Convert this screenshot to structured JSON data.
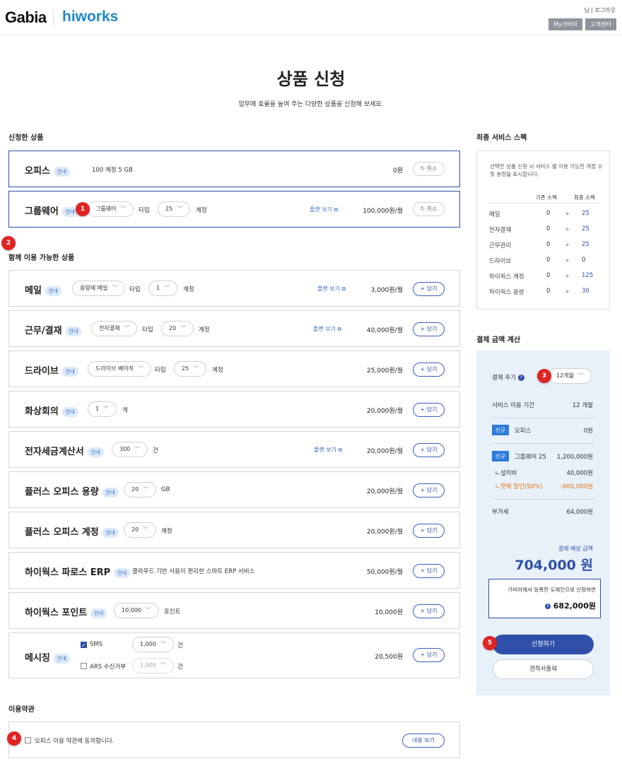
{
  "header": {
    "logo_gabia": "Gabia",
    "logo_hiworks": "hiworks",
    "user_links": "님 | 로그아웃",
    "my_gabia": "My가비아",
    "support": "고객센터"
  },
  "page": {
    "title": "상품 신청",
    "subtitle": "업무에 효율을 높여 주는 다양한 상품을 신청해 보세요."
  },
  "applied": {
    "section_title": "신청한 상품",
    "office": {
      "name": "오피스",
      "badge": "안내",
      "desc": "100 계정 5 GB",
      "price": "0원",
      "cancel": "취소"
    },
    "groupware": {
      "name": "그룹웨어",
      "badge": "안내",
      "type_select": "그룹웨어",
      "type_label": "타입",
      "count_select": "25",
      "unit": "계정",
      "plan": "플랜 보기",
      "price": "100,000원/월",
      "cancel": "취소"
    }
  },
  "available": {
    "section_title": "함께 이용 가능한 상품",
    "add_label": "담기",
    "mail": {
      "name": "메일",
      "badge": "안내",
      "type_select": "용량제 메일",
      "type_label": "타입",
      "count_select": "1",
      "unit": "계정",
      "plan": "플랜 보기",
      "price": "3,000원/월"
    },
    "approval": {
      "name": "근무/결재",
      "badge": "안내",
      "type_select": "전자결재",
      "type_label": "타입",
      "count_select": "20",
      "unit": "계정",
      "plan": "플랜 보기",
      "price": "40,000원/월"
    },
    "drive": {
      "name": "드라이브",
      "badge": "안내",
      "type_select": "드라이브 베이직",
      "type_label": "타입",
      "count_select": "25",
      "unit": "계정",
      "price": "25,000원/월"
    },
    "video": {
      "name": "화상회의",
      "badge": "안내",
      "count_select": "1",
      "unit": "개",
      "price": "20,000원/월"
    },
    "tax": {
      "name": "전자세금계산서",
      "badge": "안내",
      "count_select": "300",
      "unit": "건",
      "plan": "플랜 보기",
      "price": "20,000원/월"
    },
    "plus_storage": {
      "name": "플러스 오피스 용량",
      "badge": "안내",
      "count_select": "20",
      "unit": "GB",
      "price": "20,000원/월"
    },
    "plus_account": {
      "name": "플러스 오피스 계정",
      "badge": "안내",
      "count_select": "20",
      "unit": "계정",
      "price": "20,000원/월"
    },
    "erp": {
      "name": "하이웍스 파로스 ERP",
      "badge": "안내",
      "desc": "클라우드 기반 사용이 편리한 스마트 ERP 서비스",
      "price": "50,000원/월"
    },
    "point": {
      "name": "하이웍스 포인트",
      "badge": "안내",
      "count_select": "10,000",
      "unit": "포인트",
      "price": "10,000원"
    },
    "messaging": {
      "name": "메시징",
      "badge": "안내",
      "sms_label": "SMS",
      "sms_select": "1,000",
      "sms_unit": "건",
      "ars_label": "ARS 수신거부",
      "ars_select": "1,000",
      "ars_unit": "건",
      "price": "20,500원"
    }
  },
  "terms": {
    "section_title": "이용약관",
    "agree_text": "오피스 이용 약관에 동의합니다.",
    "view_button": "내용 보기"
  },
  "spec": {
    "section_title": "최종 서비스 스펙",
    "desc": "선택한 상품 신청 시 서비스 별 이용 가능한 계정 수 및 용량을 표시합니다.",
    "col_base": "기존 스펙",
    "col_final": "최종 스펙",
    "rows": [
      {
        "name": "메일",
        "base": "0",
        "final": "25"
      },
      {
        "name": "전자결재",
        "base": "0",
        "final": "25"
      },
      {
        "name": "근무관리",
        "base": "0",
        "final": "25"
      },
      {
        "name": "드라이브",
        "base": "0",
        "final": "0"
      },
      {
        "name": "하이웍스 계정",
        "base": "0",
        "final": "125"
      },
      {
        "name": "하이웍스 용량",
        "base": "0",
        "final": "30"
      }
    ]
  },
  "payment": {
    "section_title": "결제 금액 계산",
    "cycle_label": "결제 주기",
    "cycle_value": "12개월",
    "period_label": "서비스 이용 기간",
    "period_value": "12 개월",
    "new_tag": "신규",
    "office_label": "오피스",
    "office_value": "0원",
    "gw_label": "그룹웨어 25",
    "gw_value": "1,200,000원",
    "setup_label": "ㄴ설치비",
    "setup_value": "40,000원",
    "discount_label": "ㄴ첫해 할인(50%)",
    "discount_value": "-600,000원",
    "vat_label": "부가세",
    "vat_value": "64,000원",
    "total_label": "결제 예상 금액",
    "total_value": "704,000 원",
    "domain_note": "가비아에서 등록한 도메인으로 신청하면",
    "domain_price": "682,000원",
    "apply_button": "신청하기",
    "quote_button": "견적서출력",
    "accent": "#2f4fa8",
    "discount_color": "#e8730c"
  },
  "markers": [
    "1",
    "2",
    "3",
    "4",
    "5"
  ]
}
